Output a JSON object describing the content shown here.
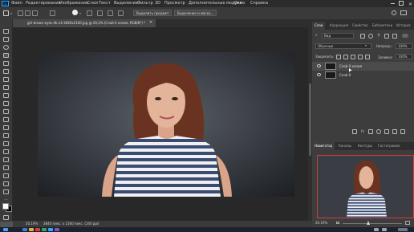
{
  "app": {
    "logo": "Ps"
  },
  "menu": [
    "Файл",
    "Редактирование",
    "Изображение",
    "Слои",
    "Текст",
    "Выделение",
    "Фильтр",
    "3D",
    "Просмотр",
    "Дополнительные модули",
    "Окно",
    "Справка"
  ],
  "options_bar": {
    "select_subject": "Выделить предмет",
    "select_and_mask": "Выделение и маска..."
  },
  "document": {
    "tab_title": "girl-brown-eyes-4k-x3-3840x2160.jpg @ 20,2% (Слой 0 копия, RGB/8*) *",
    "zoom": "20,19%",
    "dimensions": "3840 пикс. x 2160 пикс. (240 ppi)"
  },
  "layers_panel": {
    "tabs": [
      "Слои",
      "Коррекция",
      "Свойства",
      "Библиотеки",
      "История"
    ],
    "active_tab": "Слои",
    "filter_label": "Вид",
    "blend_mode": "Обычные",
    "opacity_label": "Непрозр.:",
    "opacity_value": "100%",
    "lock_label": "Закрепить:",
    "fill_label": "Заливка:",
    "fill_value": "100%",
    "layers": [
      {
        "name": "Слой 0 копия",
        "selected": true
      },
      {
        "name": "Слой 0",
        "selected": false
      }
    ]
  },
  "navigator_panel": {
    "tabs": [
      "Навигатор",
      "Каналы",
      "Контуры",
      "Гистограмма"
    ],
    "active_tab": "Навигатор",
    "zoom": "20.19%"
  },
  "colors": {
    "accent": "#31a8ff",
    "navigator_frame": "#d43c3c",
    "selected_layer": "#4b4b4b"
  }
}
